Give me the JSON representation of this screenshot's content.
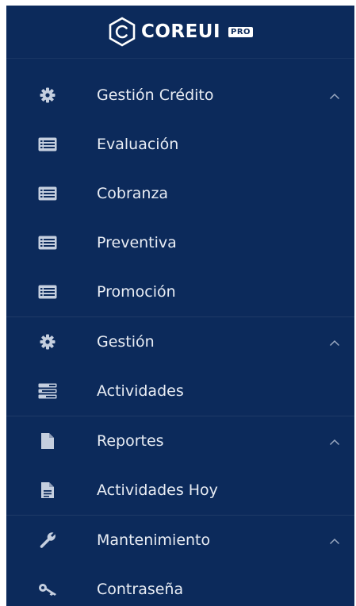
{
  "brand": {
    "name": "COREUI",
    "badge": "PRO"
  },
  "nav": [
    {
      "label": "Gestión Crédito",
      "icon": "gear-icon",
      "group": true
    },
    {
      "label": "Evaluación",
      "icon": "list-icon"
    },
    {
      "label": "Cobranza",
      "icon": "list-icon"
    },
    {
      "label": "Preventiva",
      "icon": "list-icon"
    },
    {
      "label": "Promoción",
      "icon": "list-icon"
    },
    {
      "label": "Gestión",
      "icon": "gear-icon",
      "group": true
    },
    {
      "label": "Actividades",
      "icon": "tasks-icon"
    },
    {
      "label": "Reportes",
      "icon": "file-icon",
      "group": true
    },
    {
      "label": "Actividades Hoy",
      "icon": "file-text-icon"
    },
    {
      "label": "Mantenimiento",
      "icon": "wrench-icon",
      "group": true
    },
    {
      "label": "Contraseña",
      "icon": "key-icon"
    }
  ],
  "colors": {
    "sidebar_bg": "#0c2a5b",
    "text": "#e9edf4",
    "icon": "#c5cfdf"
  }
}
